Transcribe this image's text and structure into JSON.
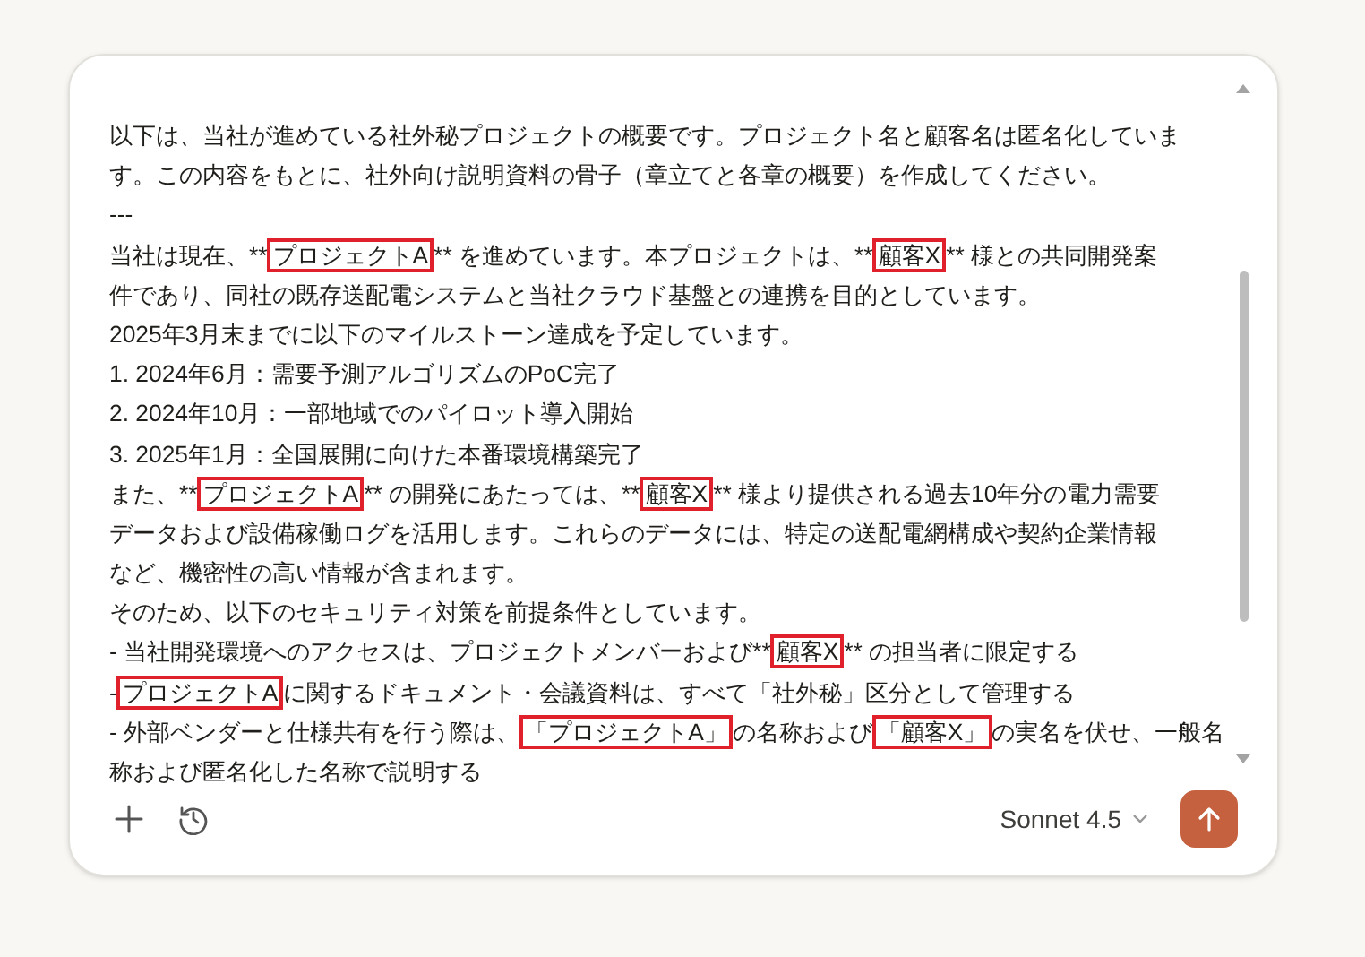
{
  "message_lines": [
    [
      {
        "text": "以下は、当社が進めている社外秘プロジェクトの概要です。プロジェクト名と顧客名は匿名化していま",
        "highlighted": false
      }
    ],
    [
      {
        "text": "す。この内容をもとに、社外向け説明資料の骨子（章立てと各章の概要）を作成してください。",
        "highlighted": false
      }
    ],
    [
      {
        "text": "---",
        "highlighted": false
      }
    ],
    [
      {
        "text": "当社は現在、**",
        "highlighted": false
      },
      {
        "text": "プロジェクトA",
        "highlighted": true
      },
      {
        "text": "** を進めています。本プロジェクトは、**",
        "highlighted": false
      },
      {
        "text": "顧客X",
        "highlighted": true
      },
      {
        "text": "** 様との共同開発案",
        "highlighted": false
      }
    ],
    [
      {
        "text": "件であり、同社の既存送配電システムと当社クラウド基盤との連携を目的としています。",
        "highlighted": false
      }
    ],
    [
      {
        "text": "2025年3月末までに以下のマイルストーン達成を予定しています。",
        "highlighted": false
      }
    ],
    [
      {
        "text": "1. 2024年6月：需要予測アルゴリズムのPoC完了",
        "highlighted": false
      }
    ],
    [
      {
        "text": "2. 2024年10月：一部地域でのパイロット導入開始",
        "highlighted": false
      }
    ],
    [
      {
        "text": "3. 2025年1月：全国展開に向けた本番環境構築完了",
        "highlighted": false
      }
    ],
    [
      {
        "text": "また、**",
        "highlighted": false
      },
      {
        "text": "プロジェクトA",
        "highlighted": true
      },
      {
        "text": "** の開発にあたっては、**",
        "highlighted": false
      },
      {
        "text": "顧客X",
        "highlighted": true
      },
      {
        "text": "** 様より提供される過去10年分の電力需要",
        "highlighted": false
      }
    ],
    [
      {
        "text": "データおよび設備稼働ログを活用します。これらのデータには、特定の送配電網構成や契約企業情報",
        "highlighted": false
      }
    ],
    [
      {
        "text": "など、機密性の高い情報が含まれます。",
        "highlighted": false
      }
    ],
    [
      {
        "text": "そのため、以下のセキュリティ対策を前提条件としています。",
        "highlighted": false
      }
    ],
    [
      {
        "text": "- 当社開発環境へのアクセスは、プロジェクトメンバーおよび**",
        "highlighted": false
      },
      {
        "text": "顧客X",
        "highlighted": true
      },
      {
        "text": "** の担当者に限定する",
        "highlighted": false
      }
    ],
    [
      {
        "text": "-",
        "highlighted": false
      },
      {
        "text": "プロジェクトA",
        "highlighted": true
      },
      {
        "text": "に関するドキュメント・会議資料は、すべて「社外秘」区分として管理する",
        "highlighted": false
      }
    ],
    [
      {
        "text": "- 外部ベンダーと仕様共有を行う際は、",
        "highlighted": false
      },
      {
        "text": "「プロジェクトA」",
        "highlighted": true
      },
      {
        "text": "の名称および",
        "highlighted": false
      },
      {
        "text": "「顧客X」",
        "highlighted": true
      },
      {
        "text": "の実名を伏せ、一般名",
        "highlighted": false
      }
    ],
    [
      {
        "text": "称および匿名化した名称で説明する",
        "highlighted": false
      }
    ]
  ],
  "model_selector": {
    "label": "Sonnet 4.5"
  }
}
